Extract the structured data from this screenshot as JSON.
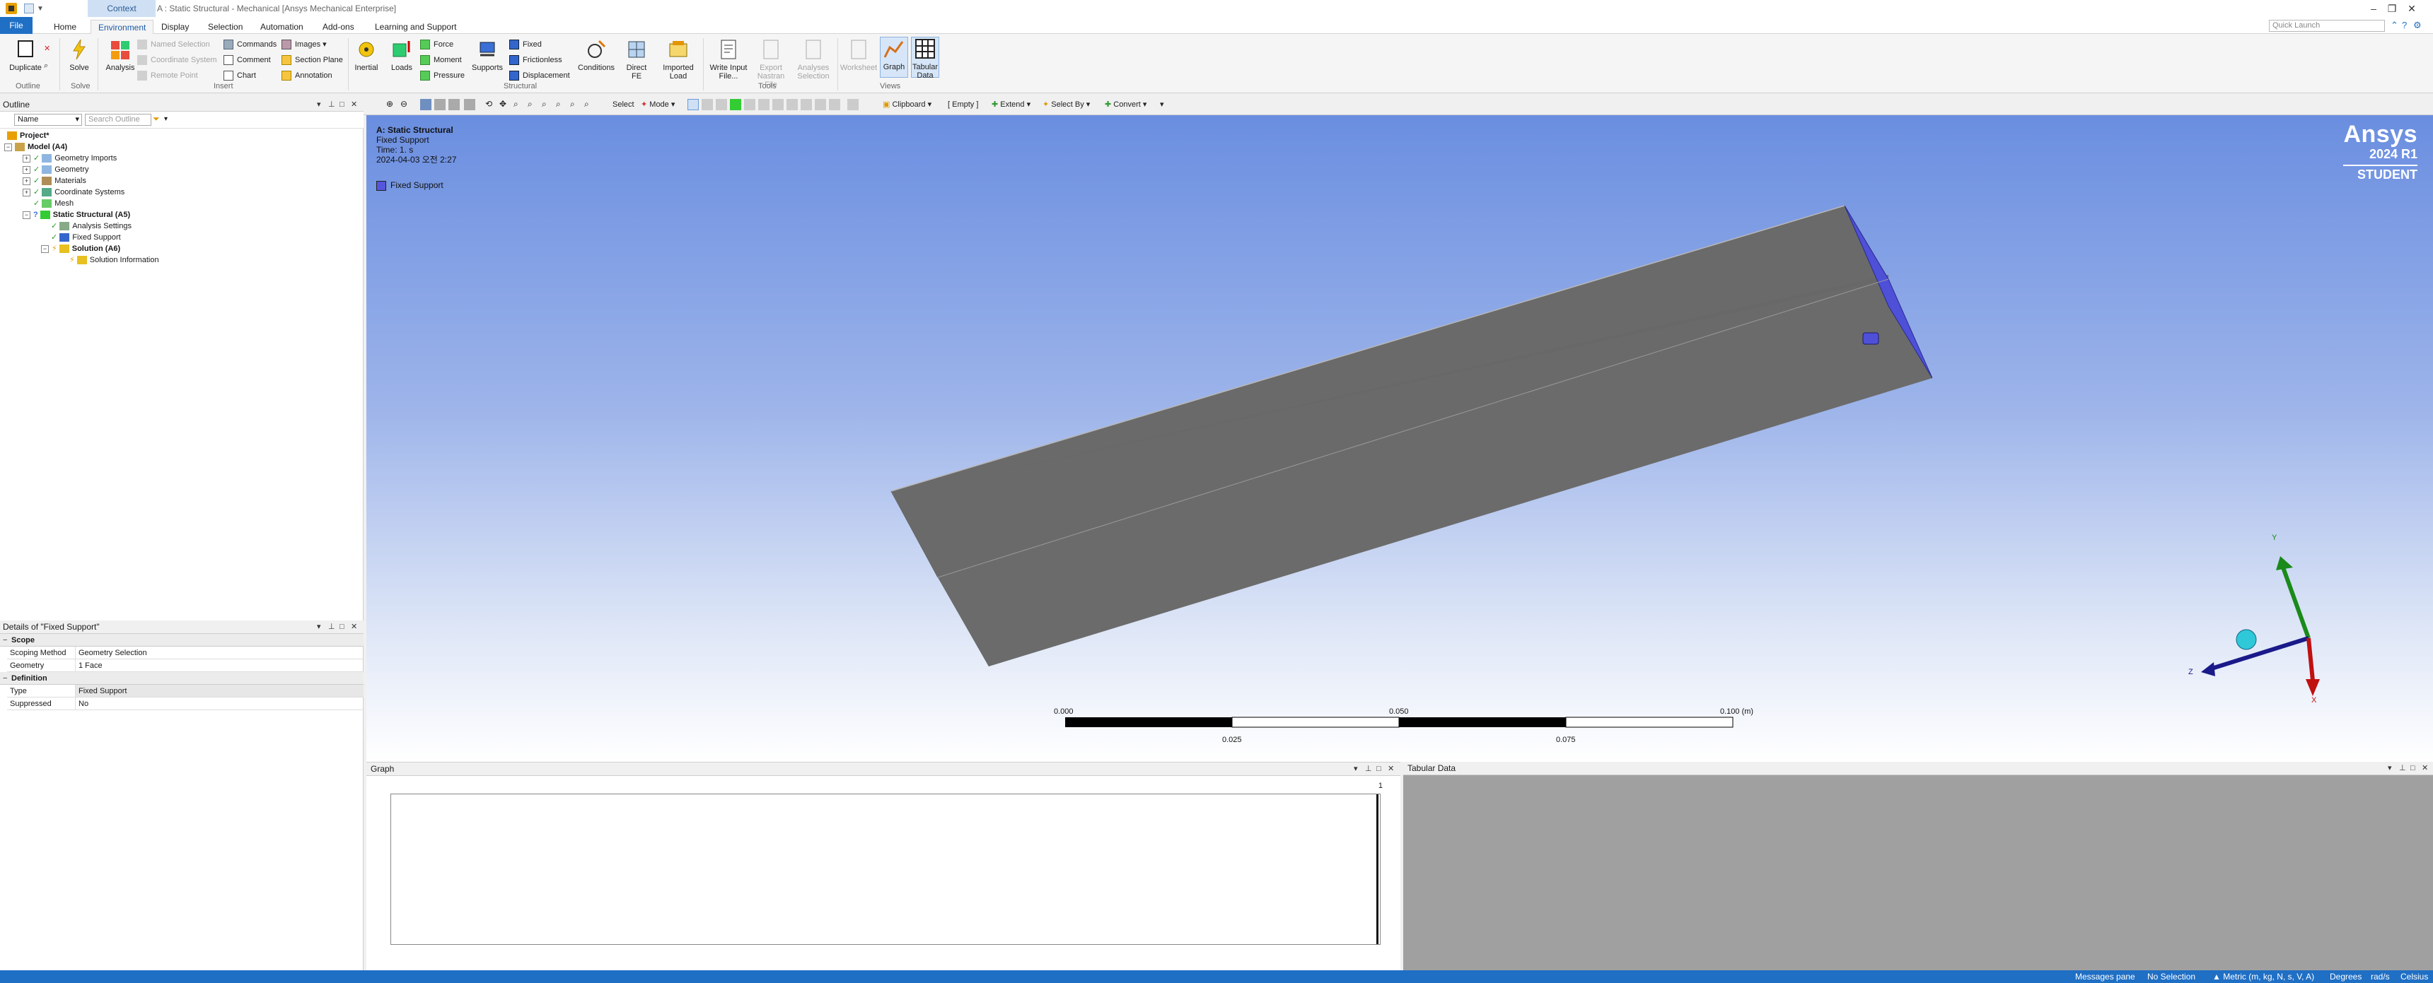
{
  "window": {
    "context_tab": "Context",
    "title": "A : Static Structural - Mechanical [Ansys Mechanical Enterprise]"
  },
  "tabs": [
    "File",
    "Home",
    "Environment",
    "Display",
    "Selection",
    "Automation",
    "Add-ons",
    "Learning and Support"
  ],
  "quick_launch_placeholder": "Quick Launch",
  "ribbon": {
    "outline": {
      "duplicate": "Duplicate",
      "group": "Outline"
    },
    "solve": {
      "solve": "Solve",
      "group": "Solve"
    },
    "insert": {
      "analysis": "Analysis",
      "named_selection": "Named Selection",
      "coordinate_system": "Coordinate System",
      "remote_point": "Remote Point",
      "commands": "Commands",
      "comment": "Comment",
      "chart": "Chart",
      "images": "Images",
      "section_plane": "Section Plane",
      "annotation": "Annotation",
      "group": "Insert"
    },
    "structural": {
      "inertial": "Inertial",
      "loads": "Loads",
      "force": "Force",
      "moment": "Moment",
      "pressure": "Pressure",
      "supports": "Supports",
      "fixed": "Fixed",
      "frictionless": "Frictionless",
      "displacement": "Displacement",
      "conditions": "Conditions",
      "direct_fe": "Direct FE",
      "imported_load": "Imported Load",
      "group": "Structural"
    },
    "tools": {
      "write_input": "Write Input File...",
      "export_nastran": "Export Nastran File",
      "analyses_selection": "Analyses Selection",
      "group": "Tools"
    },
    "views": {
      "worksheet": "Worksheet",
      "graph": "Graph",
      "tabular": "Tabular Data",
      "group": "Views"
    }
  },
  "toolbar": {
    "select": "Select",
    "mode": "Mode",
    "clipboard": "Clipboard",
    "empty": "[ Empty ]",
    "extend": "Extend",
    "select_by": "Select By",
    "convert": "Convert"
  },
  "outline": {
    "title": "Outline",
    "filter_value": "Name",
    "search_placeholder": "Search Outline",
    "tree": [
      {
        "label": "Project*",
        "indent": 0,
        "bold": true
      },
      {
        "label": "Model (A4)",
        "indent": 1,
        "bold": true
      },
      {
        "label": "Geometry Imports",
        "indent": 2,
        "bold": false
      },
      {
        "label": "Geometry",
        "indent": 2,
        "bold": false
      },
      {
        "label": "Materials",
        "indent": 2,
        "bold": false
      },
      {
        "label": "Coordinate Systems",
        "indent": 2,
        "bold": false
      },
      {
        "label": "Mesh",
        "indent": 2,
        "bold": false
      },
      {
        "label": "Static Structural (A5)",
        "indent": 2,
        "bold": true
      },
      {
        "label": "Analysis Settings",
        "indent": 3,
        "bold": false
      },
      {
        "label": "Fixed Support",
        "indent": 3,
        "bold": false
      },
      {
        "label": "Solution (A6)",
        "indent": 3,
        "bold": true
      },
      {
        "label": "Solution Information",
        "indent": 4,
        "bold": false
      }
    ]
  },
  "details": {
    "title": "Details of \"Fixed Support\"",
    "scope": "Scope",
    "scoping_method_key": "Scoping Method",
    "scoping_method_val": "Geometry Selection",
    "geometry_key": "Geometry",
    "geometry_val": "1 Face",
    "definition": "Definition",
    "type_key": "Type",
    "type_val": "Fixed Support",
    "suppressed_key": "Suppressed",
    "suppressed_val": "No"
  },
  "viewport": {
    "analysis": "A: Static Structural",
    "object": "Fixed Support",
    "time": "Time: 1. s",
    "date": "2024-04-03 오전 2:27",
    "legend": "Fixed Support",
    "brand": "Ansys",
    "version": "2024 R1",
    "edition": "STUDENT",
    "scale": {
      "l0": "0.000",
      "l1": "0.050",
      "l2": "0.100 (m)",
      "l3": "0.025",
      "l4": "0.075"
    },
    "axes": {
      "x": "X",
      "y": "Y",
      "z": "Z"
    }
  },
  "graph": {
    "title": "Graph",
    "tick": "1"
  },
  "tabular": {
    "title": "Tabular Data"
  },
  "status": {
    "messages": "Messages pane",
    "selection": "No Selection",
    "units": "Metric (m, kg, N, s, V, A)",
    "angle": "Degrees",
    "rate": "rad/s",
    "temp": "Celsius"
  },
  "colors": {
    "accent": "#1f6fc5",
    "support_face": "#5555dd"
  }
}
